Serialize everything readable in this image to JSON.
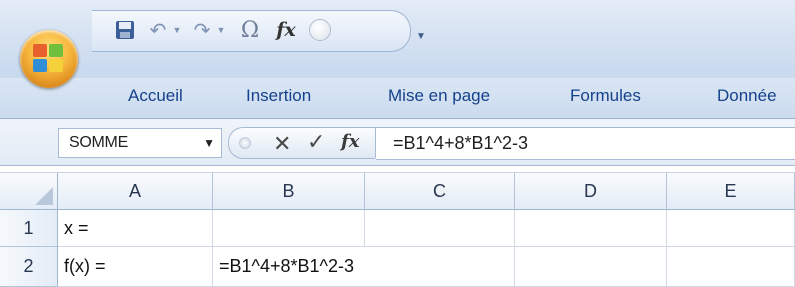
{
  "quick_access": {
    "buttons": [
      "save-icon",
      "undo-icon",
      "redo-icon",
      "omega-symbol-icon",
      "function-fx-icon",
      "circle-icon",
      "customize-dropdown-icon"
    ],
    "omega_glyph": "Ω",
    "fx_glyph": "fx"
  },
  "ribbon": {
    "tabs": [
      "Accueil",
      "Insertion",
      "Mise en page",
      "Formules",
      "Donnée"
    ]
  },
  "formula_bar": {
    "name_box": "SOMME",
    "fx_glyph": "fx",
    "formula": "=B1^4+8*B1^2-3"
  },
  "grid": {
    "columns": [
      "A",
      "B",
      "C",
      "D",
      "E"
    ],
    "rows": [
      {
        "number": "1",
        "cells": [
          "x =",
          "",
          "",
          "",
          ""
        ]
      },
      {
        "number": "2",
        "cells": [
          "f(x) =",
          "=B1^4+8*B1^2-3",
          "",
          "",
          ""
        ]
      }
    ]
  },
  "colors": {
    "ribbon_text": "#15428b",
    "office_orange": "#f6b43a",
    "header_border": "#9eb6ce"
  }
}
